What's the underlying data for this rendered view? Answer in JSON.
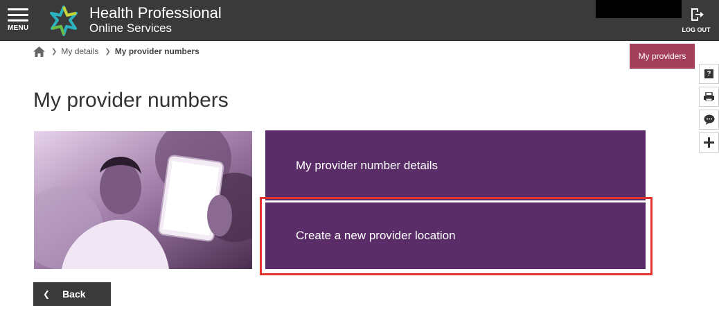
{
  "header": {
    "menu_label": "MENU",
    "brand_title": "Health Professional",
    "brand_subtitle": "Online Services",
    "logout_label": "LOG OUT"
  },
  "breadcrumb": {
    "items": [
      "My details",
      "My provider numbers"
    ]
  },
  "actions": {
    "my_providers_label": "My providers"
  },
  "page": {
    "title": "My provider numbers"
  },
  "tiles": [
    {
      "label": "My provider number details"
    },
    {
      "label": "Create a new provider location"
    }
  ],
  "back_label": "Back",
  "colors": {
    "topbar": "#3a3a3a",
    "accent": "#a33e5b",
    "tile": "#5a2d69",
    "highlight": "#e3342f"
  },
  "icons": {
    "side_tools": [
      "help-icon",
      "print-icon",
      "chat-icon",
      "plus-icon"
    ]
  }
}
